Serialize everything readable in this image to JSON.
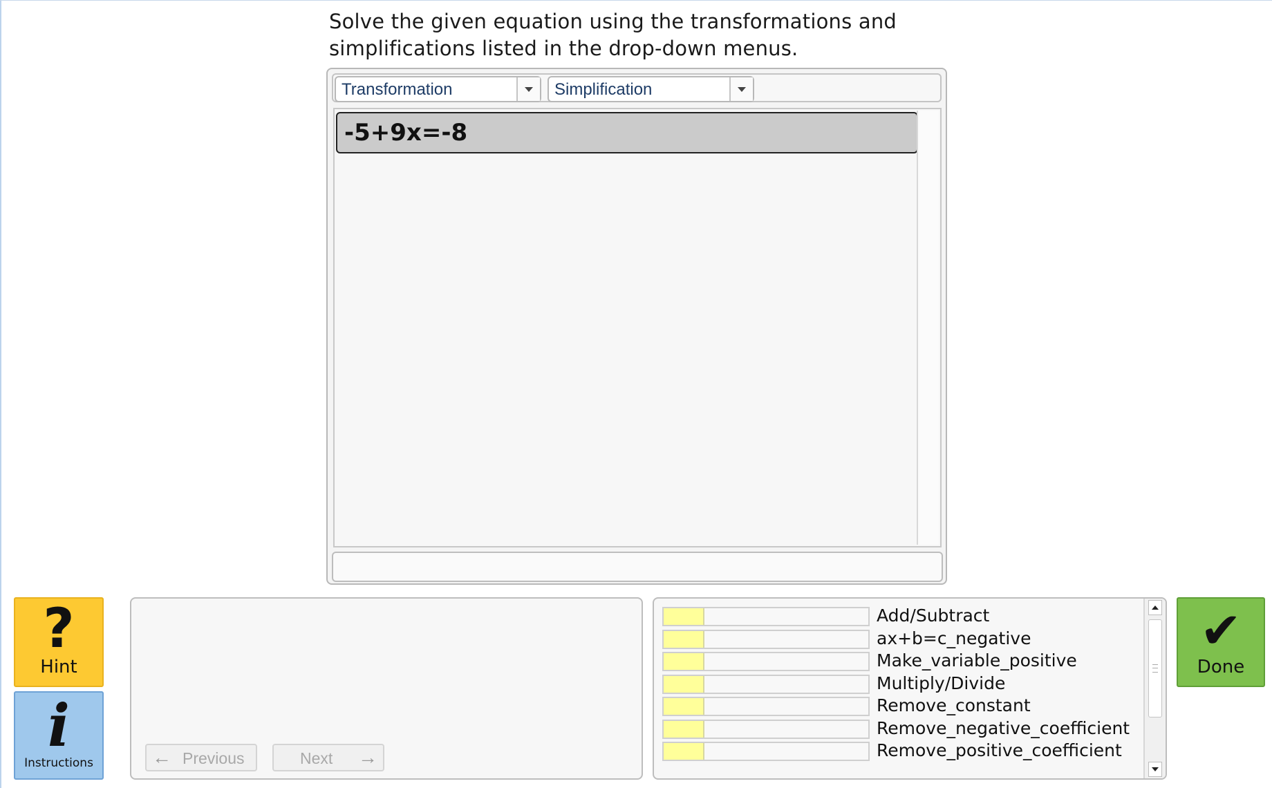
{
  "instructions": {
    "line1": "Solve the given equation using the transformations and",
    "line2": "simplifications listed in the drop-down menus."
  },
  "dropdowns": {
    "transformation": "Transformation",
    "simplification": "Simplification"
  },
  "work_area": {
    "equation": "-5+9x=-8"
  },
  "side_buttons": {
    "hint_icon": "?",
    "hint_label": "Hint",
    "info_icon": "i",
    "info_label": "Instructions"
  },
  "navigation": {
    "previous_label": "Previous",
    "next_label": "Next",
    "previous_icon": "←",
    "next_icon": "→"
  },
  "skills": [
    {
      "name": "Add/Subtract",
      "mastery": 0.2
    },
    {
      "name": "ax+b=c_negative",
      "mastery": 0.2
    },
    {
      "name": "Make_variable_positive",
      "mastery": 0.2
    },
    {
      "name": "Multiply/Divide",
      "mastery": 0.2
    },
    {
      "name": "Remove_constant",
      "mastery": 0.2
    },
    {
      "name": "Remove_negative_coefficient",
      "mastery": 0.2
    },
    {
      "name": "Remove_positive_coefficient",
      "mastery": 0.2
    }
  ],
  "done": {
    "icon": "✔",
    "label": "Done"
  },
  "colors": {
    "hint_bg": "#fdc932",
    "instructions_bg": "#9fc8ec",
    "done_bg": "#7ec04d",
    "skill_fill": "#ffff9a",
    "equation_row_bg": "#cbcbcb"
  }
}
